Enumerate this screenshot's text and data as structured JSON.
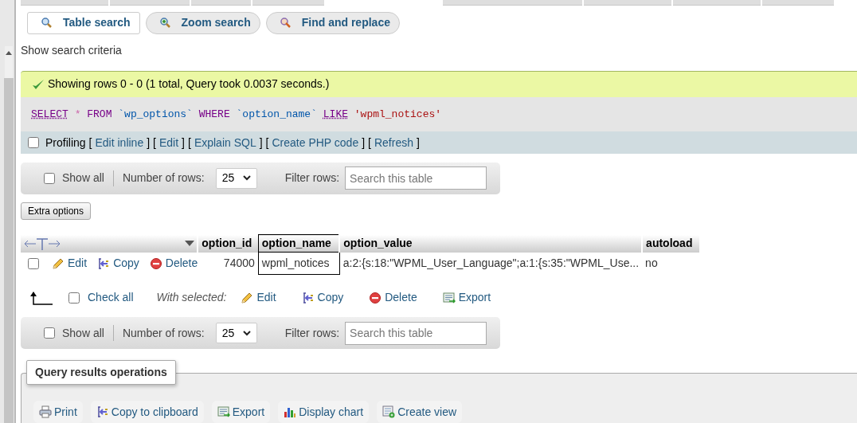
{
  "search_tabs": [
    {
      "label": "Table search",
      "selected": true,
      "kind": "search"
    },
    {
      "label": "Zoom search",
      "selected": false,
      "kind": "zoom"
    },
    {
      "label": "Find and replace",
      "selected": false,
      "kind": "replace"
    }
  ],
  "criteria_link": "Show search criteria",
  "success_message": "Showing rows 0 - 0 (1 total, Query took 0.0037 seconds.)",
  "sql_tokens": [
    {
      "text": "SELECT",
      "kind": "keyword_link"
    },
    {
      "text": "*",
      "kind": "star"
    },
    {
      "text": "FROM",
      "kind": "keyword"
    },
    {
      "text": "`wp_options`",
      "kind": "name"
    },
    {
      "text": "WHERE",
      "kind": "keyword"
    },
    {
      "text": "`option_name`",
      "kind": "name"
    },
    {
      "text": "LIKE",
      "kind": "keyword_link"
    },
    {
      "text": "'wpml_notices'",
      "kind": "string"
    }
  ],
  "profiling": {
    "checked": false,
    "label": "Profiling",
    "open": "[",
    "close": "]",
    "links": [
      "Edit inline",
      "Edit",
      "Explain SQL",
      "Create PHP code",
      "Refresh"
    ]
  },
  "navigation": [
    {
      "show_all": "Show all",
      "show_all_checked": false,
      "rows_label": "Number of rows:",
      "rows_value": "25",
      "filter_label": "Filter rows:",
      "filter_placeholder": "Search this table"
    },
    {
      "show_all": "Show all",
      "show_all_checked": false,
      "rows_label": "Number of rows:",
      "rows_value": "25",
      "filter_label": "Filter rows:",
      "filter_placeholder": "Search this table"
    }
  ],
  "extra_options": "Extra options",
  "table": {
    "columns": [
      {
        "label": "option_id",
        "highlighted": false
      },
      {
        "label": "option_name",
        "highlighted": true
      },
      {
        "label": "option_value",
        "highlighted": false
      },
      {
        "label": "autoload",
        "highlighted": false
      }
    ],
    "rows": [
      {
        "checked": false,
        "actions": [
          {
            "label": "Edit",
            "kind": "edit"
          },
          {
            "label": "Copy",
            "kind": "copy"
          },
          {
            "label": "Delete",
            "kind": "delete"
          }
        ],
        "cells": [
          "74000",
          "wpml_notices",
          "a:2:{s:18:\"WPML_User_Language\";a:1:{s:35:\"WPML_Use...",
          "no"
        ]
      }
    ]
  },
  "bulk": {
    "check_all": "Check all",
    "checked": false,
    "with_selected": "With selected:",
    "actions": [
      {
        "label": "Edit",
        "kind": "edit"
      },
      {
        "label": "Copy",
        "kind": "copy"
      },
      {
        "label": "Delete",
        "kind": "delete"
      },
      {
        "label": "Export",
        "kind": "export"
      }
    ]
  },
  "operations": {
    "title": "Query results operations",
    "actions": [
      {
        "label": "Print",
        "kind": "print"
      },
      {
        "label": "Copy to clipboard",
        "kind": "copy"
      },
      {
        "label": "Export",
        "kind": "export"
      },
      {
        "label": "Display chart",
        "kind": "chart"
      },
      {
        "label": "Create view",
        "kind": "view"
      }
    ]
  }
}
